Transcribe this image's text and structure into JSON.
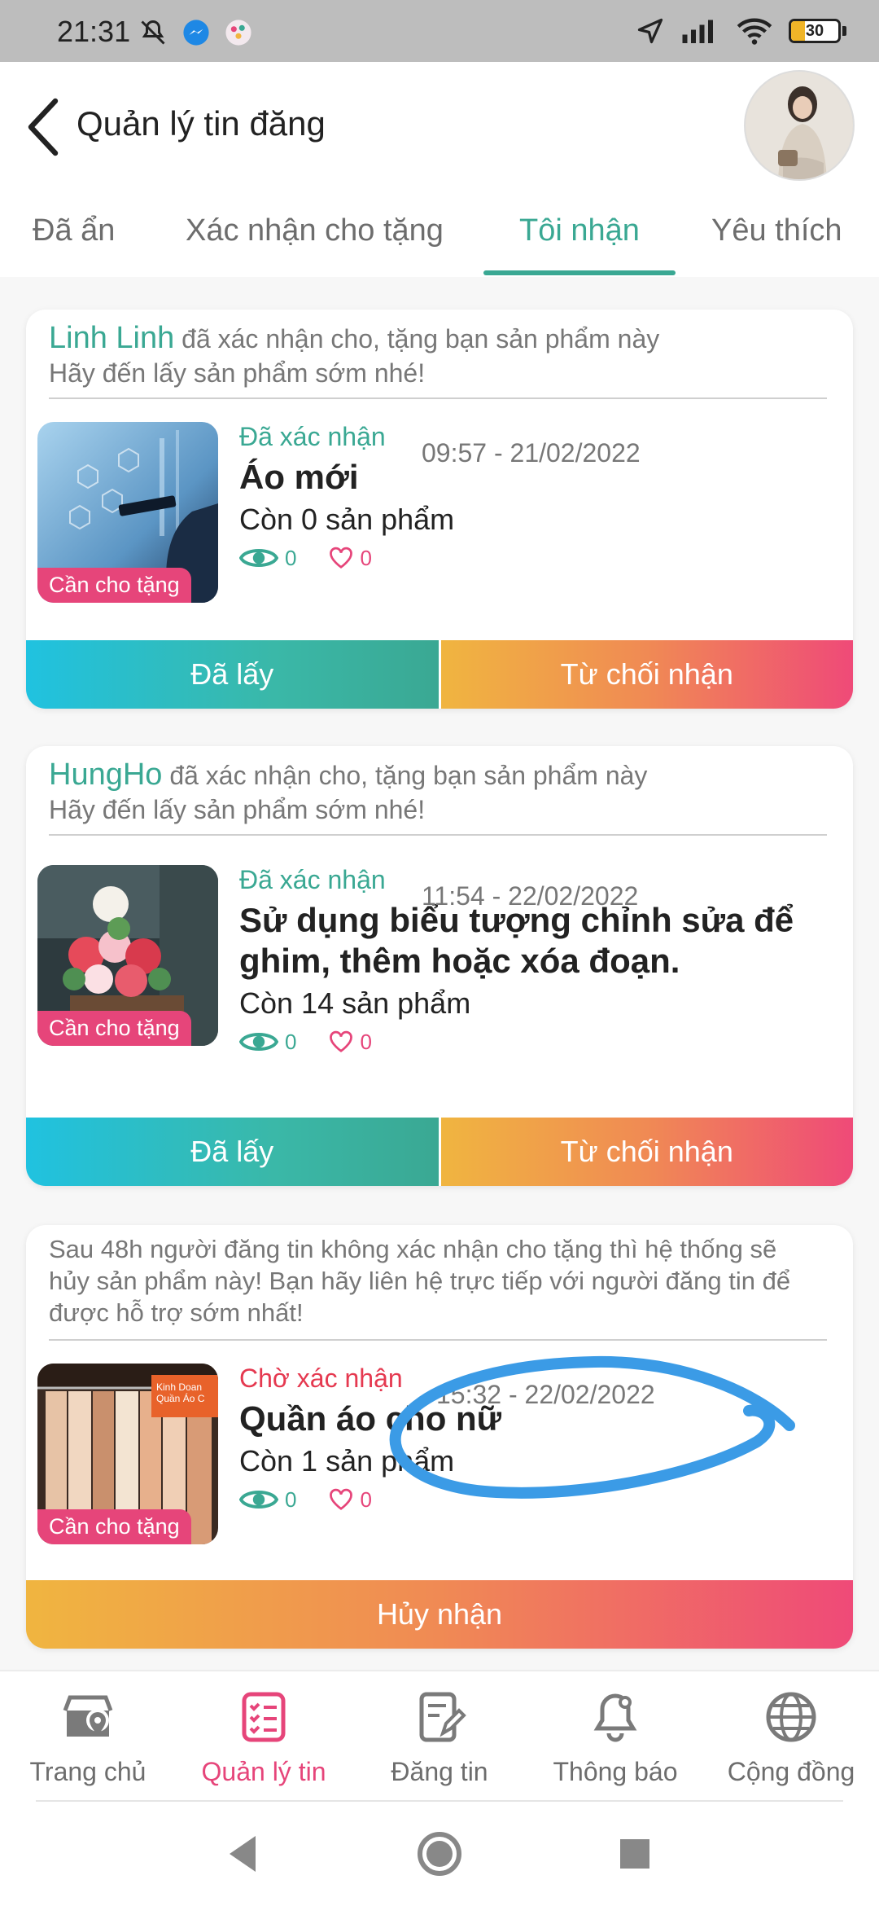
{
  "status_bar": {
    "time": "21:31",
    "battery": "30",
    "battery_level": 0.3,
    "icons": [
      "mute-icon",
      "messenger-icon",
      "app-icon",
      "location-icon",
      "signal-icon",
      "wifi-icon",
      "battery-icon"
    ]
  },
  "header": {
    "title": "Quản lý tin đăng"
  },
  "tabs": [
    {
      "label": "Đã ẩn",
      "active": false
    },
    {
      "label": "Xác nhận cho tặng",
      "active": false
    },
    {
      "label": "Tôi nhận",
      "active": true
    },
    {
      "label": "Yêu thích",
      "active": false
    }
  ],
  "cards": [
    {
      "user": "Linh Linh",
      "message": " đã xác nhận cho, tặng bạn sản phẩm này",
      "note": "Hãy đến lấy sản phẩm sớm nhé!",
      "tag": "Cần cho tặng",
      "status": "Đã xác nhận",
      "time": "09:57 - 21/02/2022",
      "title": "Áo mới",
      "stock": "Còn 0 sản phẩm",
      "views": "0",
      "likes": "0",
      "btn_taken": "Đã lấy",
      "btn_reject": "Từ chối nhận"
    },
    {
      "user": "HungHo",
      "message": " đã xác nhận cho, tặng bạn sản phẩm này",
      "note": "Hãy đến lấy sản phẩm sớm nhé!",
      "tag": "Cần cho tặng",
      "status": "Đã xác nhận",
      "time": "11:54 - 22/02/2022",
      "title": "Sử dụng biểu tượng chỉnh sửa để ghim, thêm hoặc xóa đoạn.",
      "stock": "Còn 14 sản phẩm",
      "views": "0",
      "likes": "0",
      "btn_taken": "Đã lấy",
      "btn_reject": "Từ chối nhận"
    },
    {
      "warning": "Sau 48h người đăng tin không xác nhận cho tặng thì hệ thống sẽ hủy sản phẩm này! Bạn hãy liên hệ trực tiếp với người đăng tin để được hỗ trợ sớm nhất!",
      "tag": "Cần cho tặng",
      "thumb_text": "Kinh Doan Quần Áo C",
      "status": "Chờ xác nhận",
      "time": "15:32 - 22/02/2022",
      "title": "Quần áo cho nữ",
      "stock": "Còn 1 sản phẩm",
      "views": "0",
      "likes": "0",
      "btn_cancel": "Hủy nhận"
    }
  ],
  "bottom_nav": [
    {
      "label": "Trang chủ",
      "icon": "store-location-icon",
      "active": false
    },
    {
      "label": "Quản lý tin",
      "icon": "checklist-icon",
      "active": true
    },
    {
      "label": "Đăng tin",
      "icon": "edit-document-icon",
      "active": false
    },
    {
      "label": "Thông báo",
      "icon": "bell-icon",
      "active": false
    },
    {
      "label": "Cộng đồng",
      "icon": "globe-icon",
      "active": false
    }
  ],
  "colors": {
    "accent_green": "#3aa893",
    "accent_pink": "#e6457a",
    "pending_red": "#e53950",
    "annotation_blue": "#3b9be6"
  }
}
